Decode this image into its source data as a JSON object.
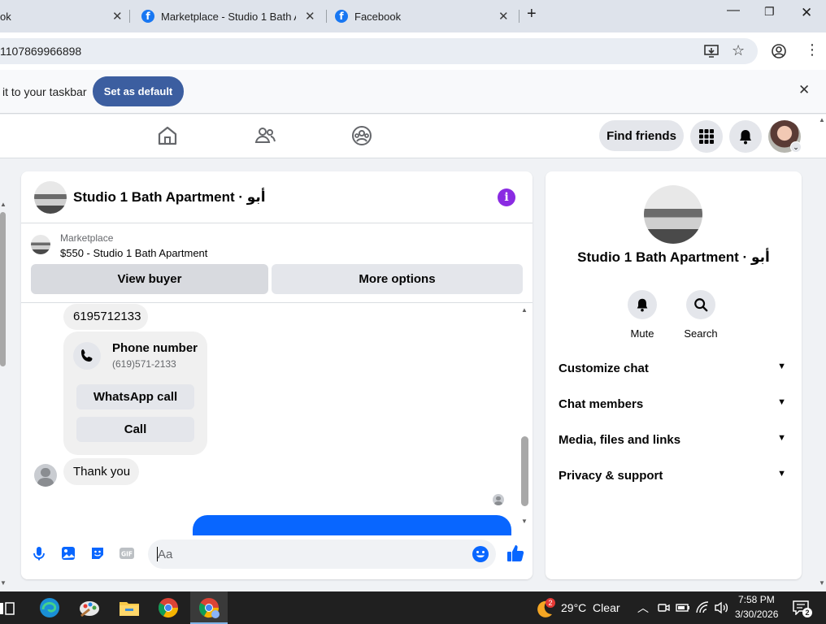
{
  "browser": {
    "tabs": [
      {
        "title": "ok"
      },
      {
        "title": "Marketplace - Studio 1 Bath Ap"
      },
      {
        "title": "Facebook"
      }
    ],
    "address": "1107869966898",
    "infobar": {
      "text": "it to your taskbar",
      "button": "Set as default"
    }
  },
  "nav": {
    "find_friends": "Find friends"
  },
  "chat": {
    "title": "Studio 1 Bath Apartment · أبو",
    "marketplace_label": "Marketplace",
    "listing_title": "$550 - Studio 1 Bath Apartment",
    "view_buyer": "View buyer",
    "more_options": "More options",
    "messages": {
      "number_bubble": "6195712133",
      "phone_card_title": "Phone number",
      "phone_card_number": "(619)571-2133",
      "whatsapp_call": "WhatsApp call",
      "call": "Call",
      "thank_you": "Thank you"
    },
    "composer_placeholder": "Aa"
  },
  "panel": {
    "name": "Studio 1 Bath Apartment · أبو",
    "mute": "Mute",
    "search": "Search",
    "sections": [
      "Customize chat",
      "Chat members",
      "Media, files and links",
      "Privacy & support"
    ]
  },
  "taskbar": {
    "weather_badge": "2",
    "weather": "29°C  Clear",
    "time": "7:58 PM",
    "date": "3/30/2026",
    "notif_count": "2"
  },
  "colors": {
    "fb_blue": "#0866ff",
    "info_purple": "#8a2be2",
    "default_btn": "#3c5ea0"
  }
}
